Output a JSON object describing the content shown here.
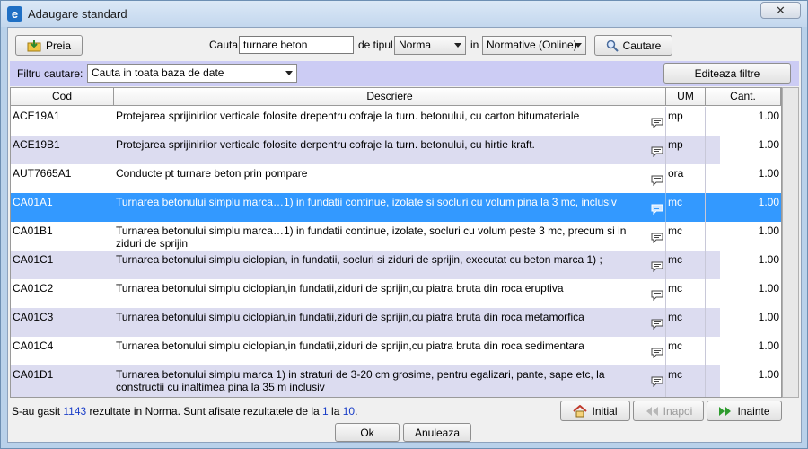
{
  "window": {
    "title": "Adaugare standard",
    "close_glyph": "✕"
  },
  "toolbar": {
    "preia_label": "Preia",
    "cauta_label": "Cauta",
    "search_value": "turnare beton",
    "de_tipul_label": "de tipul",
    "type_value": "Norma",
    "in_label": "in",
    "source_value": "Normative (Online)",
    "cautare_label": "Cautare"
  },
  "filter": {
    "label": "Filtru cautare:",
    "value": "Cauta in toata baza de date",
    "edit_label": "Editeaza filtre"
  },
  "grid": {
    "headers": {
      "code": "Cod",
      "desc": "Descriere",
      "um": "UM",
      "qty": "Cant."
    },
    "rows": [
      {
        "code": "ACE19A1",
        "desc": "Protejarea sprijinirilor verticale folosite drepentru cofraje la turn. betonului, cu carton bitumateriale",
        "um": "mp",
        "qty": "1.00"
      },
      {
        "code": "ACE19B1",
        "desc": "Protejarea sprijinirilor verticale folosite derpentru cofraje la turn. betonului, cu hirtie kraft.",
        "um": "mp",
        "qty": "1.00"
      },
      {
        "code": "AUT7665A1",
        "desc": "Conducte pt turnare beton prin pompare",
        "um": "ora",
        "qty": "1.00"
      },
      {
        "code": "CA01A1",
        "desc": "Turnarea betonului simplu marca…1) in fundatii continue, izolate si socluri cu volum pina la 3 mc, inclusiv",
        "um": "mc",
        "qty": "1.00"
      },
      {
        "code": "CA01B1",
        "desc": "Turnarea betonului simplu marca…1) in fundatii continue, izolate, socluri cu volum peste 3 mc, precum si in ziduri de sprijin",
        "um": "mc",
        "qty": "1.00"
      },
      {
        "code": "CA01C1",
        "desc": "Turnarea betonului simplu ciclopian, in fundatii, socluri si ziduri de sprijin, executat cu beton marca 1) ;",
        "um": "mc",
        "qty": "1.00"
      },
      {
        "code": "CA01C2",
        "desc": "Turnarea betonului simplu ciclopian,in fundatii,ziduri de sprijin,cu piatra bruta din roca eruptiva",
        "um": "mc",
        "qty": "1.00"
      },
      {
        "code": "CA01C3",
        "desc": "Turnarea betonului simplu ciclopian,in fundatii,ziduri de sprijin,cu piatra bruta din roca metamorfica",
        "um": "mc",
        "qty": "1.00"
      },
      {
        "code": "CA01C4",
        "desc": "Turnarea betonului simplu ciclopian,in fundatii,ziduri de sprijin,cu piatra bruta din roca sedimentara",
        "um": "mc",
        "qty": "1.00"
      },
      {
        "code": "CA01D1",
        "desc": "Turnarea betonului simplu marca 1) in straturi de 3-20 cm grosime, pentru egalizari, pante, sape etc, la constructii cu inaltimea pina la 35 m inclusiv",
        "um": "mc",
        "qty": "1.00"
      }
    ]
  },
  "status": {
    "prefix": "S-au gasit",
    "count": "1143",
    "middle": "rezultate in Norma. Sunt afisate rezultatele de la",
    "from": "1",
    "la": "la",
    "to": "10",
    "suffix": "."
  },
  "nav": {
    "initial": "Initial",
    "inapoi": "Inapoi",
    "inainte": "Inainte"
  },
  "footer": {
    "ok": "Ok",
    "cancel": "Anuleaza"
  }
}
